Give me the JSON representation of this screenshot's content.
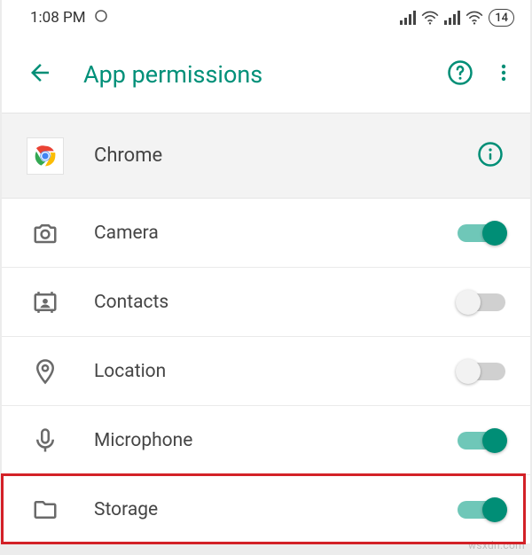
{
  "status": {
    "time": "1:08 PM",
    "battery": "14"
  },
  "header": {
    "title": "App permissions"
  },
  "app": {
    "name": "Chrome"
  },
  "permissions": [
    {
      "key": "camera",
      "label": "Camera",
      "enabled": true
    },
    {
      "key": "contacts",
      "label": "Contacts",
      "enabled": false
    },
    {
      "key": "location",
      "label": "Location",
      "enabled": false
    },
    {
      "key": "microphone",
      "label": "Microphone",
      "enabled": true
    },
    {
      "key": "storage",
      "label": "Storage",
      "enabled": true
    }
  ],
  "highlight_permission": "storage",
  "watermark": "wsxdn.com"
}
